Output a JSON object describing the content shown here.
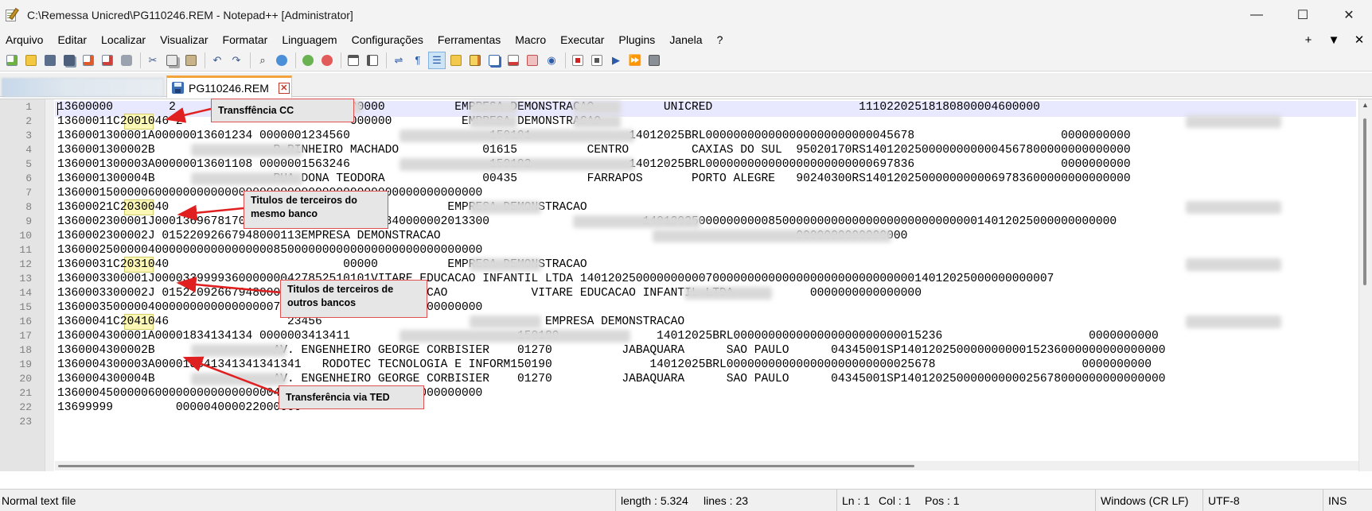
{
  "window": {
    "title": "C:\\Remessa Unicred\\PG110246.REM - Notepad++ [Administrator]",
    "controls": {
      "minimize": "—",
      "maximize": "☐",
      "close": "✕"
    }
  },
  "menu": {
    "items": [
      "Arquivo",
      "Editar",
      "Localizar",
      "Visualizar",
      "Formatar",
      "Linguagem",
      "Configurações",
      "Ferramentas",
      "Macro",
      "Executar",
      "Plugins",
      "Janela",
      "?"
    ],
    "right": {
      "add": "+",
      "dropdown": "▼",
      "close": "✕"
    }
  },
  "toolbar": {
    "icons": [
      "new-file-icon",
      "open-file-icon",
      "save-icon",
      "save-all-icon",
      "close-icon",
      "close-all-icon",
      "print-icon",
      "cut-icon",
      "copy-icon",
      "paste-icon",
      "undo-icon",
      "redo-icon",
      "find-icon",
      "replace-icon",
      "zoom-in-icon",
      "zoom-out-icon",
      "sync-vertical-icon",
      "sync-horizontal-icon",
      "word-wrap-icon",
      "show-all-chars-icon",
      "indent-guide-icon",
      "user-language-icon",
      "doc-map-icon",
      "function-list-icon",
      "folder-workspace-icon",
      "monitoring-icon",
      "record-macro-icon",
      "stop-record-icon",
      "play-macro-icon",
      "run-macro-multiple-icon",
      "save-macro-icon"
    ]
  },
  "tabs": {
    "active": {
      "label": "PG110246.REM",
      "close": "✕"
    }
  },
  "editor": {
    "line_numbers": [
      "1",
      "2",
      "3",
      "4",
      "5",
      "6",
      "7",
      "8",
      "9",
      "10",
      "11",
      "12",
      "13",
      "14",
      "15",
      "16",
      "17",
      "18",
      "19",
      "20",
      "21",
      "22",
      "23"
    ],
    "lines": [
      "13600000        2                        000000          EMPRESA DEMONSTRACAO          UNICRED                     11102202518180800004600000",
      "13600011C2001046 2                        000000          EMPRESA DEMONSTRACAO",
      "1360001300001A00000013601234 0000001234560                    150191              14012025BRL000000000000000000000000045678                     0000000000",
      "1360001300002B                 R PINHEIRO MACHADO            01615          CENTRO         CAXIAS DO SUL  95020170RS14012025000000000004567800000000000000",
      "1360001300003A00000013601108 0000001563246                    150192              14012025BRL000000000000000000000000697836                     0000000000",
      "1360001300004B                 RUA DONA TEODORA              00435          FARRAPOS       PORTO ALEGRE   90240300RS14012025000000000069783600000000000000",
      "1360001500000600000000000000000000000000000000000000000000000",
      "13600021C2030040                         00000          EMPRESA DEMONSTRACAO",
      "1360002300001J000136967817000008500524100002229840000002013300                      14012025000000000085000000000000000000000000000014012025000000000000",
      "1360002300002J 01522092667948000113EMPRESA DEMONSTRACAO                                                   0000000000000000",
      "1360002500000400000000000000000850000000000000000000000000000",
      "13600031C2031040                         00000          EMPRESA DEMONSTRACAO",
      "1360003300001J0000339999360000000427852510101VITARE EDUCACAO INFANTIL LTDA 14012025000000000070000000000000000000000000000014012025000000000007",
      "1360003300002J 015220926679480000113EMPRESA DEMONSTRACAO            VITARE EDUCACAO INFANTIL LTDA           0000000000000000",
      "1360003500000400000000000000000700000000000000000000000000000",
      "13600041C2041046                 23456                                EMPRESA DEMONSTRACAO",
      "1360004300001A00001834134134 0000003413411                        150189              14012025BRL000000000000000000000000015236                     0000000000",
      "1360004300002B                 AV. ENGENHEIRO GEORGE CORBISIER    01270          JABAQUARA      SAO PAULO      04345001SP14012025000000000015236000000000000000",
      "1360004300003A000018341341341341341   RODOTEC TECNOLOGIA E INFORM150190              14012025BRL000000000000000000000000025678                     0000000000",
      "1360004300004B                 AV. ENGENHEIRO GEORGE CORBISIER    01270          JABAQUARA      SAO PAULO      04345001SP14012025000000000025678000000000000000",
      "1360004500000600000000000000000409140000000000000000000000000",
      "13699999         000004000022000000",
      ""
    ]
  },
  "annotations": {
    "transf_cc": "Transffência CC",
    "titulos_mesmo_banco": "Titulos de terceiros do mesmo banco",
    "titulos_outros_bancos": "Titulos de terceiros de outros  bancos",
    "transf_ted": "Transferência via TED"
  },
  "highlighted_codes": [
    "2001",
    "2030",
    "2031",
    "2041"
  ],
  "status": {
    "file_type": "Normal text file",
    "length": "length : 5.324",
    "lines": "lines : 23",
    "ln": "Ln : 1",
    "col": "Col : 1",
    "pos": "Pos : 1",
    "eol": "Windows (CR LF)",
    "encoding": "UTF-8",
    "mode": "INS"
  }
}
